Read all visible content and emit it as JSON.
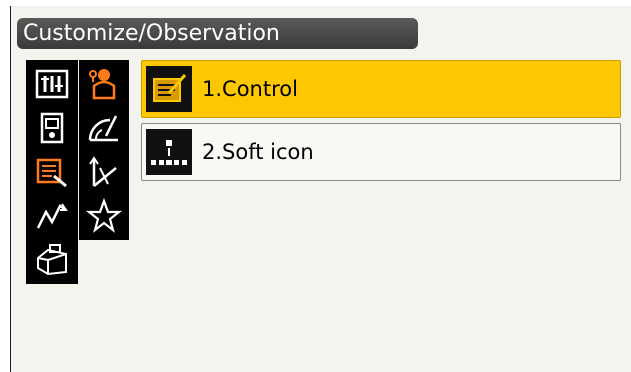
{
  "title": "Customize/Observation",
  "sidebar_col1": [
    "observation-settings-icon",
    "instrument-icon",
    "document-edit-icon",
    "graph-line-icon",
    "toolbox-icon"
  ],
  "sidebar_col2": [
    "operator-icon",
    "angle-measure-icon",
    "vector-axes-icon",
    "star-icon"
  ],
  "menu": [
    {
      "label": "1.Control",
      "icon": "pencil-notepad-icon",
      "selected": true
    },
    {
      "label": "2.Soft icon",
      "icon": "soft-icon-dots-icon",
      "selected": false
    }
  ],
  "colors": {
    "selected": "#fdc800",
    "accent_icon": "#ff7a1a",
    "titlebar": "#4a4a4a"
  }
}
